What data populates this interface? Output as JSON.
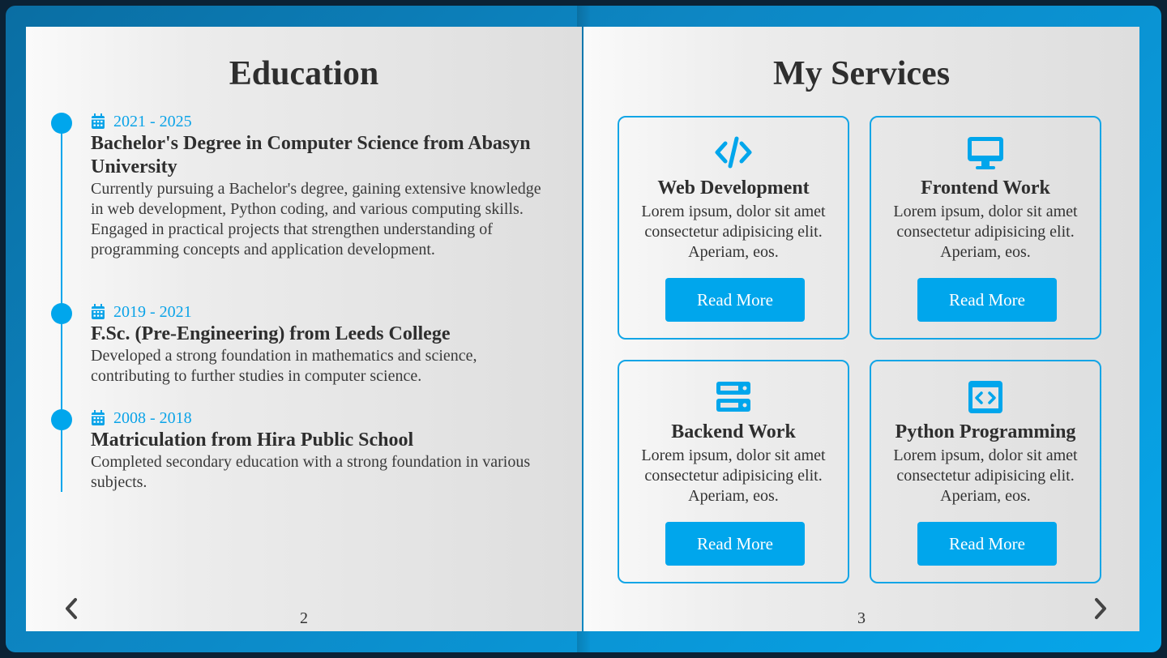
{
  "left_page": {
    "title": "Education",
    "page_number": "2",
    "items": [
      {
        "years": "2021 - 2025",
        "title": "Bachelor's Degree in Computer Science from Abasyn University",
        "description": "Currently pursuing a Bachelor's degree, gaining extensive knowledge in web development, Python coding, and various computing skills. Engaged in practical projects that strengthen understanding of programming concepts and application development."
      },
      {
        "years": "2019 - 2021",
        "title": "F.Sc. (Pre-Engineering) from Leeds College",
        "description": "Developed a strong foundation in mathematics and science, contributing to further studies in computer science."
      },
      {
        "years": "2008 - 2018",
        "title": "Matriculation from Hira Public School",
        "description": "Completed secondary education with a strong foundation in various subjects."
      }
    ]
  },
  "right_page": {
    "title": "My Services",
    "page_number": "3",
    "services": [
      {
        "icon": "code-icon",
        "title": "Web Development",
        "description": "Lorem ipsum, dolor sit amet consectetur adipisicing elit. Aperiam, eos.",
        "button": "Read More"
      },
      {
        "icon": "desktop-icon",
        "title": "Frontend Work",
        "description": "Lorem ipsum, dolor sit amet consectetur adipisicing elit. Aperiam, eos.",
        "button": "Read More"
      },
      {
        "icon": "server-icon",
        "title": "Backend Work",
        "description": "Lorem ipsum, dolor sit amet consectetur adipisicing elit. Aperiam, eos.",
        "button": "Read More"
      },
      {
        "icon": "code-file-icon",
        "title": "Python Programming",
        "description": "Lorem ipsum, dolor sit amet consectetur adipisicing elit. Aperiam, eos.",
        "button": "Read More"
      }
    ]
  },
  "colors": {
    "accent": "#00a6ec",
    "frame": "#0d87c4",
    "text": "#333333"
  }
}
